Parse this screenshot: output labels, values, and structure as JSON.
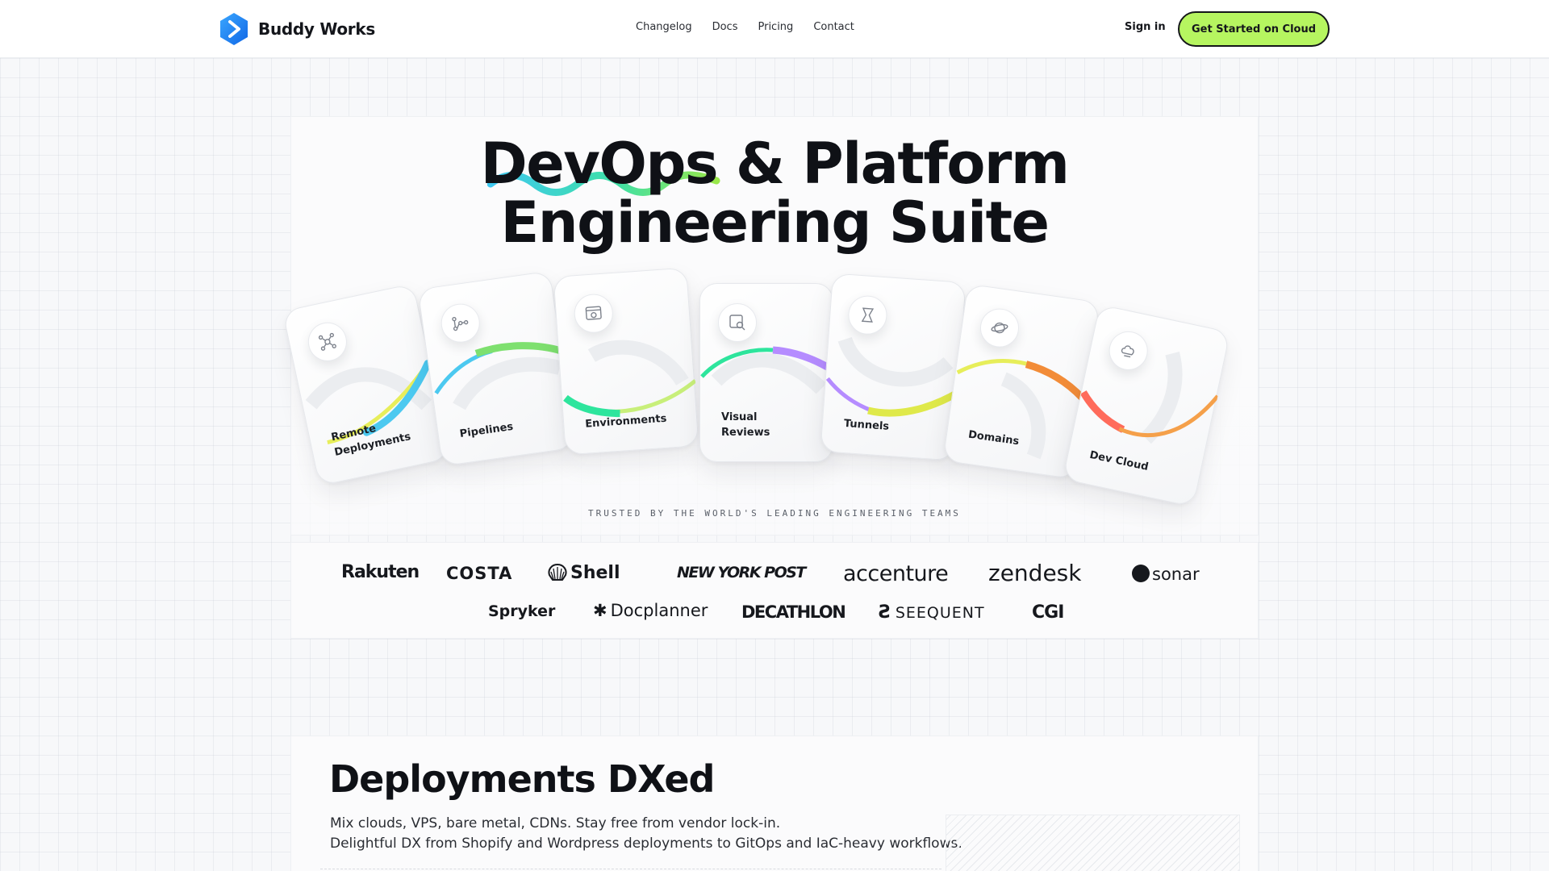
{
  "brand": {
    "name": "Buddy Works"
  },
  "nav": {
    "items": [
      "Changelog",
      "Docs",
      "Pricing",
      "Contact"
    ]
  },
  "auth": {
    "signin": "Sign in",
    "cta": "Get Started on Cloud"
  },
  "hero": {
    "title_line1": "DevOps & Platform",
    "title_line2": "Engineering Suite"
  },
  "cards": [
    {
      "label": "Remote Deployments",
      "icon": "network-icon"
    },
    {
      "label": "Pipelines",
      "icon": "pipeline-icon"
    },
    {
      "label": "Environments",
      "icon": "browser-icon"
    },
    {
      "label": "Visual Reviews",
      "icon": "magnifier-icon"
    },
    {
      "label": "Tunnels",
      "icon": "tunnel-icon"
    },
    {
      "label": "Domains",
      "icon": "planet-icon"
    },
    {
      "label": "Dev Cloud",
      "icon": "cloud-icon"
    }
  ],
  "trusted": {
    "text": "TRUSTED BY THE WORLD'S LEADING ENGINEERING TEAMS"
  },
  "logos": {
    "row1": [
      "Rakuten",
      "COSTA",
      "Shell",
      "NEW YORK POST",
      "accenture",
      "zendesk",
      "sonar"
    ],
    "row2": [
      "Spryker",
      "Docplanner",
      "DECATHLON",
      "SEEQUENT",
      "CGI"
    ]
  },
  "deployments": {
    "title": "Deployments DXed",
    "line1": "Mix clouds, VPS, bare metal, CDNs. Stay free from vendor lock-in.",
    "line2": "Delightful DX from Shopify and Wordpress deployments to GitOps and IaC-heavy workflows."
  },
  "colors": {
    "accent": "#b6f560",
    "brand_blue": "#1e9bff",
    "arc_palette": [
      "#e4ee5c",
      "#4cc9f0",
      "#7ee06f",
      "#2ee59d",
      "#b58cff",
      "#f28c38",
      "#ff6b5b"
    ]
  }
}
